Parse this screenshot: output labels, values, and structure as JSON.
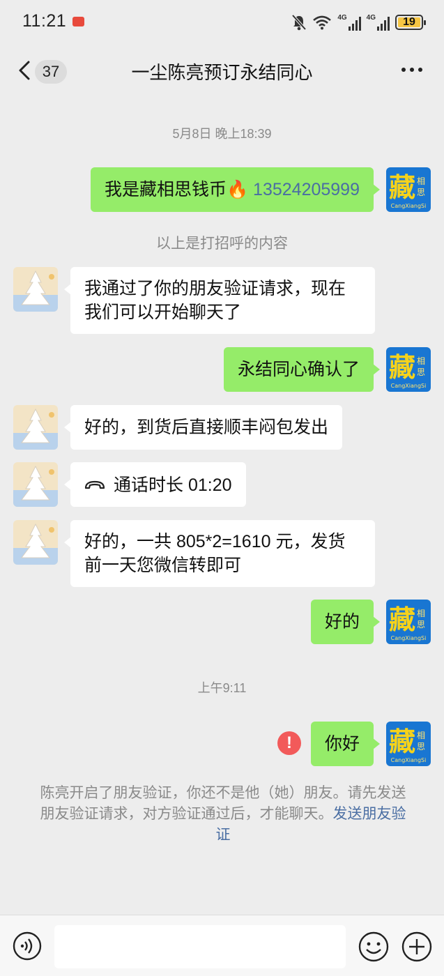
{
  "status_bar": {
    "time": "11:21",
    "network_1": "4G",
    "network_2": "4G",
    "battery": "19"
  },
  "nav": {
    "unread_count": "37",
    "title": "一尘陈亮预订永结同心"
  },
  "messages": [
    {
      "type": "time",
      "text": "5月8日 晚上18:39"
    },
    {
      "type": "out",
      "text": "我是藏相思钱币🔥 ",
      "phone": "13524205999"
    },
    {
      "type": "notice",
      "text": "以上是打招呼的内容"
    },
    {
      "type": "in",
      "line1": "我通过了你的朋友验证请求，现在",
      "line2": "我们可以开始聊天了"
    },
    {
      "type": "out",
      "text": "永结同心确认了"
    },
    {
      "type": "in",
      "text": "好的，到货后直接顺丰闷包发出"
    },
    {
      "type": "in-call",
      "text": "通话时长 01:20"
    },
    {
      "type": "in",
      "line1": "好的，一共 805*2=1610 元，发货",
      "line2": "前一天您微信转即可"
    },
    {
      "type": "out",
      "text": "好的"
    },
    {
      "type": "time",
      "text": "上午9:11"
    },
    {
      "type": "out",
      "text": "你好",
      "failed": true
    }
  ],
  "system_note": {
    "text": "陈亮开启了朋友验证，你还不是他（她）朋友。请先发送朋友验证请求，对方验证通过后，才能聊天。",
    "link": "发送朋友验证"
  },
  "my_avatar": {
    "main_char": "藏",
    "side_chars": "相思",
    "caption": "CangXiangSi"
  },
  "input_bar": {
    "placeholder": ""
  },
  "colors": {
    "background": "#ededed",
    "bubble_out": "#95ec69",
    "bubble_in": "#ffffff",
    "link": "#4a6ea3",
    "error": "#f25a5a"
  }
}
